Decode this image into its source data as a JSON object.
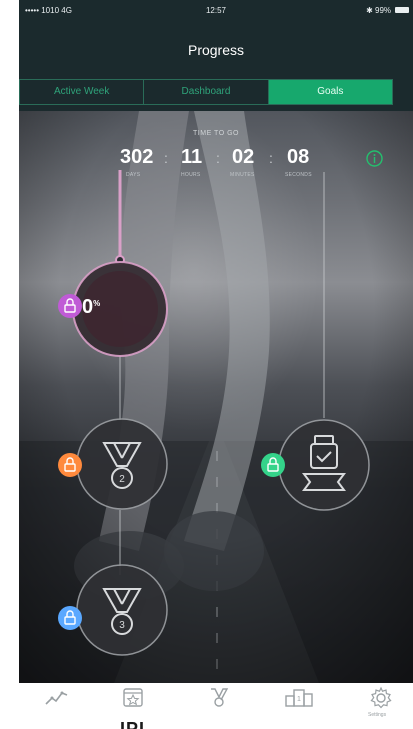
{
  "status_bar": {
    "carrier": "••••• 1010  4G",
    "time": "12:57",
    "battery": "✱ 99%"
  },
  "nav": {
    "title": "Progress"
  },
  "segments": {
    "active_week": "Active Week",
    "dashboard": "Dashboard",
    "goals": "Goals",
    "active": "Goals"
  },
  "timer": {
    "title": "TIME TO GO",
    "days": "302",
    "days_label": "DAYS",
    "hours": "11",
    "hours_label": "HOURS",
    "minutes": "02",
    "minutes_label": "MINUTES",
    "seconds": "08",
    "seconds_label": "SECONDS"
  },
  "progress": {
    "value": "0",
    "unit": "%"
  },
  "medals": [
    {
      "name": "medal-2",
      "number": "2",
      "lock_color": "#ff8a3d",
      "state": "locked"
    },
    {
      "name": "medal-3",
      "number": "3",
      "lock_color": "#5aa8ff",
      "state": "locked"
    },
    {
      "name": "watch-award",
      "lock_color": "#34d38a",
      "state": "locked"
    }
  ],
  "colors": {
    "accent": "#17a86d",
    "progress_ring": "#d9a0c8",
    "progress_lock": "#c05bd6"
  },
  "tabs": {
    "settings_label": "Settings"
  },
  "caption": "IPI"
}
